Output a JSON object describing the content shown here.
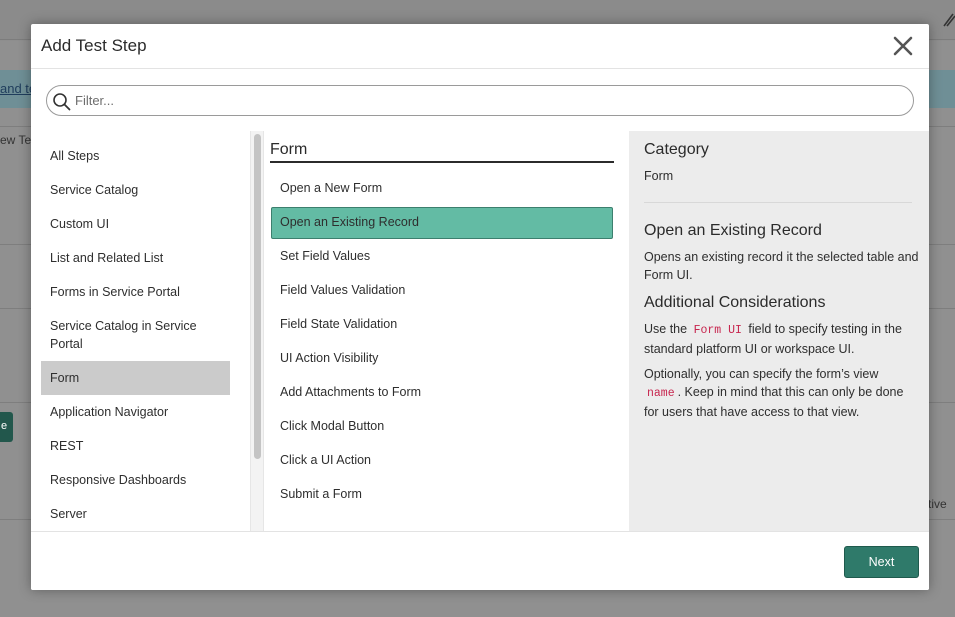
{
  "background": {
    "link_text": "and te",
    "row_text": "ew Test",
    "button_text": "e",
    "right_text": "tive"
  },
  "modal": {
    "title": "Add Test Step",
    "close_icon": "close-icon"
  },
  "filter": {
    "placeholder": "Filter...",
    "value": "",
    "icon": "search-icon"
  },
  "categories": {
    "items": [
      {
        "label": "All Steps",
        "selected": false
      },
      {
        "label": "Service Catalog",
        "selected": false
      },
      {
        "label": "Custom UI",
        "selected": false
      },
      {
        "label": "List and Related List",
        "selected": false
      },
      {
        "label": "Forms in Service Portal",
        "selected": false
      },
      {
        "label": "Service Catalog in Service Portal",
        "selected": false
      },
      {
        "label": "Form",
        "selected": true
      },
      {
        "label": "Application Navigator",
        "selected": false
      },
      {
        "label": "REST",
        "selected": false
      },
      {
        "label": "Responsive Dashboards",
        "selected": false
      },
      {
        "label": "Server",
        "selected": false
      }
    ]
  },
  "steps": {
    "header": "Form",
    "items": [
      {
        "label": "Open a New Form",
        "selected": false
      },
      {
        "label": "Open an Existing Record",
        "selected": true
      },
      {
        "label": "Set Field Values",
        "selected": false
      },
      {
        "label": "Field Values Validation",
        "selected": false
      },
      {
        "label": "Field State Validation",
        "selected": false
      },
      {
        "label": "UI Action Visibility",
        "selected": false
      },
      {
        "label": "Add Attachments to Form",
        "selected": false
      },
      {
        "label": "Click Modal Button",
        "selected": false
      },
      {
        "label": "Click a UI Action",
        "selected": false
      },
      {
        "label": "Submit a Form",
        "selected": false
      }
    ]
  },
  "detail": {
    "category_heading": "Category",
    "category_value": "Form",
    "step_title": "Open an Existing Record",
    "step_description": "Opens an existing record it the selected table and Form UI.",
    "considerations_heading": "Additional Considerations",
    "p1_before": "Use the",
    "p1_code": "Form UI",
    "p1_line1_after": "field to specify testing in the",
    "p1_line2": "standard platform UI or workspace UI.",
    "p2_line1": "Optionally, you can specify the form’s view",
    "p2_code": "name",
    "p2_line2_after": ". Keep in mind that this can only be done",
    "p2_line3": "for users that have access to that view."
  },
  "footer": {
    "next_label": "Next"
  },
  "colors": {
    "accent": "#2f7a6a",
    "selected_step": "#63bba4",
    "selected_category": "#cbcbcb",
    "code_text": "#c7254e"
  }
}
